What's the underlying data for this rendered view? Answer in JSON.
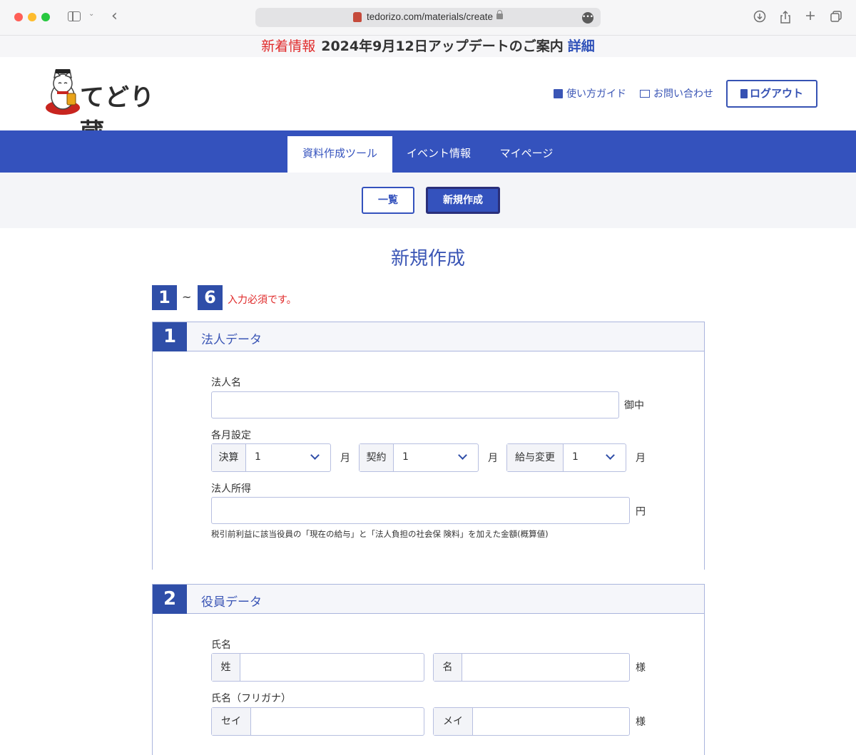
{
  "browser": {
    "url": "tedorizo.com/materials/create",
    "more_label": "•••"
  },
  "news": {
    "label": "新着情報",
    "message": "2024年9月12日アップデートのご案内",
    "detail": "詳細"
  },
  "header": {
    "logo_text": "てどり蔵",
    "guide": "使い方ガイド",
    "contact": "お問い合わせ",
    "logout": "ログアウト"
  },
  "nav": {
    "tabs": [
      {
        "label": "資料作成ツール",
        "active": true
      },
      {
        "label": "イベント情報",
        "active": false
      },
      {
        "label": "マイページ",
        "active": false
      }
    ]
  },
  "subnav": {
    "list": "一覧",
    "create": "新規作成"
  },
  "page": {
    "title": "新規作成",
    "req_from": "1",
    "req_tilde": "~",
    "req_to": "6",
    "req_text": "入力必須です。"
  },
  "section1": {
    "num": "1",
    "title": "法人データ",
    "company_label": "法人名",
    "company_unit": "御中",
    "month_label": "各月設定",
    "settlement_label": "決算",
    "settlement_value": "1",
    "contract_label": "契約",
    "contract_value": "1",
    "salary_label": "給与変更",
    "salary_value": "1",
    "month_unit": "月",
    "income_label": "法人所得",
    "income_unit": "円",
    "income_note": "税引前利益に該当役員の「現在の給与」と「法人負担の社会保 険料」を加えた金額(概算値)"
  },
  "section2": {
    "num": "2",
    "title": "役員データ",
    "name_label": "氏名",
    "last_name": "姓",
    "first_name": "名",
    "honorific": "様",
    "kana_label": "氏名（フリガナ）",
    "last_kana": "セイ",
    "first_kana": "メイ"
  }
}
